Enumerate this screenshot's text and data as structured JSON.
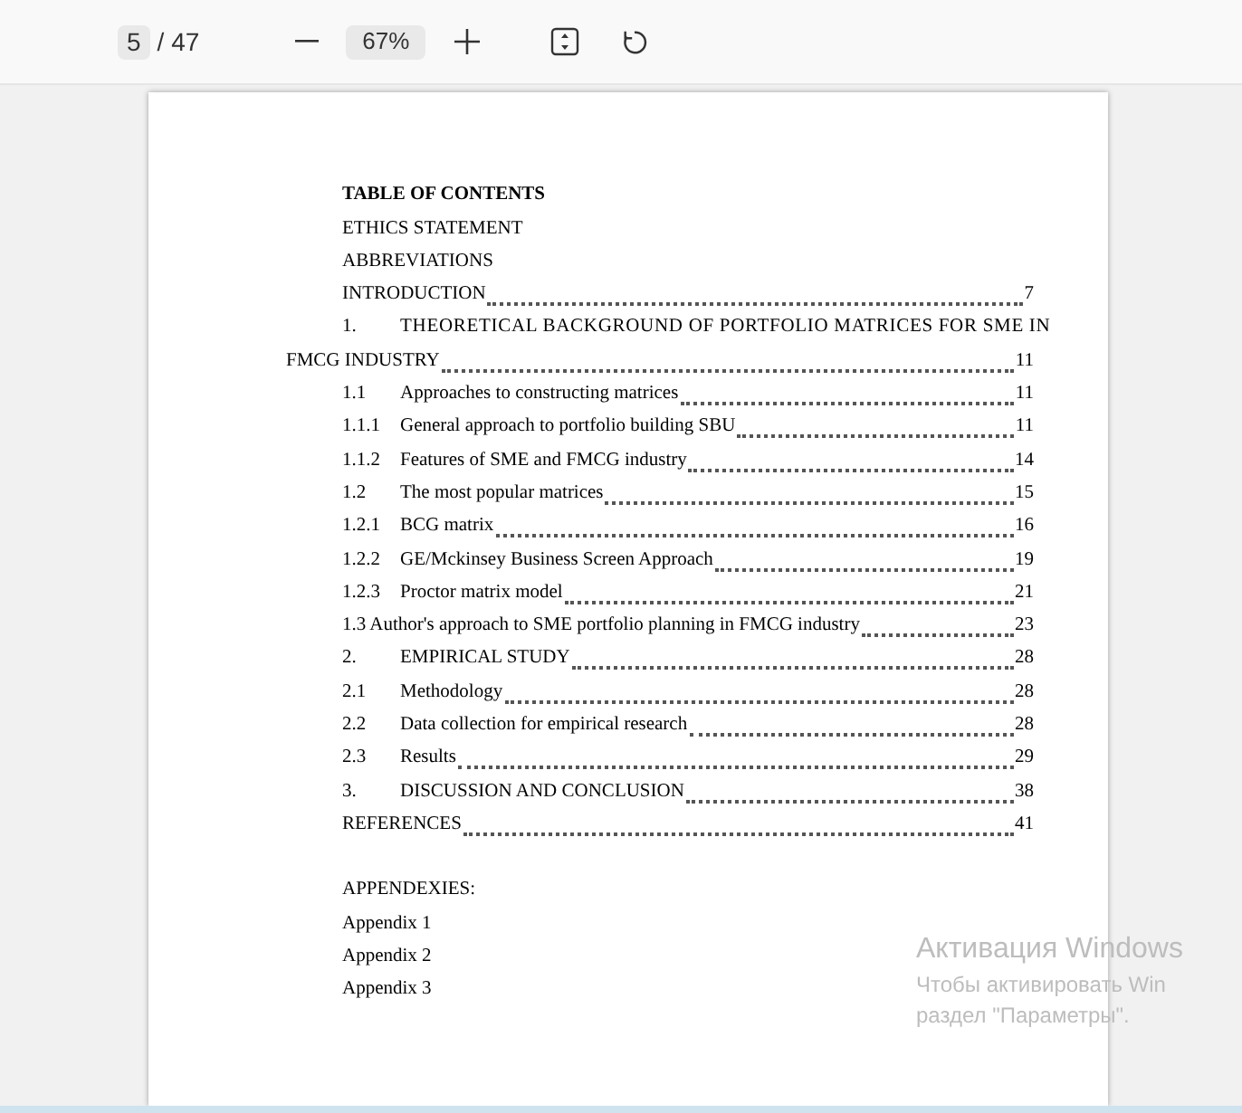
{
  "toolbar": {
    "page_number": "5",
    "page_total": "/ 47",
    "zoom": "67%"
  },
  "document": {
    "toc": [
      {
        "kind": "heading",
        "title": "TABLE OF CONTENTS"
      },
      {
        "kind": "plain",
        "title": "ETHICS STATEMENT"
      },
      {
        "kind": "plain",
        "title": "ABBREVIATIONS"
      },
      {
        "kind": "entry",
        "title": "INTRODUCTION",
        "page": "7"
      },
      {
        "kind": "wrapped",
        "number": "1.",
        "title_lines": [
          "THEORETICAL BACKGROUND OF PORTFOLIO MATRICES FOR SME IN",
          "FMCG INDUSTRY"
        ],
        "page": "11"
      },
      {
        "kind": "entry",
        "number": "1.1",
        "title": "Approaches to constructing matrices",
        "page": "11"
      },
      {
        "kind": "entry",
        "number": "1.1.1",
        "title": "General approach to portfolio building SBU",
        "page": "11"
      },
      {
        "kind": "entry",
        "number": "1.1.2",
        "title": "Features of SME and FMCG industry",
        "page": "14"
      },
      {
        "kind": "entry",
        "number": "1.2",
        "title": "The most popular matrices",
        "page": "15"
      },
      {
        "kind": "entry",
        "number": "1.2.1",
        "title": "BCG matrix",
        "page": "16"
      },
      {
        "kind": "entry",
        "number": "1.2.2",
        "title": "GE/Mckinsey Business Screen Approach",
        "page": "19"
      },
      {
        "kind": "entry",
        "number": "1.2.3",
        "title": "Proctor matrix model",
        "page": "21"
      },
      {
        "kind": "entry",
        "title": "1.3 Author's approach to SME portfolio planning in FMCG industry",
        "page": "23"
      },
      {
        "kind": "entry",
        "number": "2.",
        "title": "EMPIRICAL STUDY",
        "page": "28"
      },
      {
        "kind": "entry",
        "number": "2.1",
        "title": "Methodology",
        "page": "28"
      },
      {
        "kind": "entry",
        "number": "2.2",
        "title": "Data collection for empirical research",
        "page": "28"
      },
      {
        "kind": "entry",
        "number": "2.3",
        "title": "Results",
        "page": "29"
      },
      {
        "kind": "entry",
        "number": "3.",
        "title": "DISCUSSION AND CONCLUSION",
        "page": "38"
      },
      {
        "kind": "entry",
        "title": "REFERENCES",
        "page": "41"
      }
    ],
    "appendices_heading": "APPENDEXIES:",
    "appendices": [
      "Appendix 1",
      "Appendix 2",
      "Appendix 3"
    ]
  },
  "activation_notice": {
    "title": "Активация Windows",
    "lines": [
      "Чтобы активировать Win",
      "раздел \"Параметры\"."
    ]
  }
}
